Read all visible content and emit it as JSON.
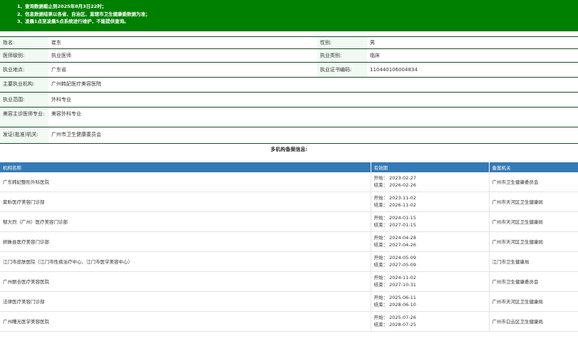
{
  "notice": [
    "1、查询数据截止到2025年8月3日22时；",
    "2、信息数据结果以各省、自治区、直辖市卫生健康委数据为准；",
    "3、凌晨1点至凌晨5点系统进行维护，不能提供查询。"
  ],
  "info": {
    "name_label": "姓名:",
    "name": "崔东",
    "gender_label": "性别:",
    "gender": "男",
    "level_label": "医师级别:",
    "level": "执业医师",
    "category_label": "执业类别:",
    "category": "临床",
    "place_label": "执业地点:",
    "place": "广东省",
    "cert_label": "执业证书编码:",
    "cert": "110440106004834",
    "org_label": "主要执业机构:",
    "org": "广州韩妃医疗美容医院",
    "scope_label": "执业范围:",
    "scope": "外科专业",
    "beauty_label": "美容主诊医师专业:",
    "beauty": "美容外科专业",
    "issuer_label": "发证(批准)机关:",
    "issuer": "广州市卫生健康委员会"
  },
  "multi_title": "多机构备案信息:",
  "orgs_header": {
    "name": "机构名称",
    "valid": "有效期",
    "authority": "备案机关"
  },
  "orgs": [
    {
      "name": "广东韩妃整形外科医院",
      "start": "开始：  2023-02-27",
      "end": "结束：  2026-02-26",
      "authority": "广州市卫生健康委员会"
    },
    {
      "name": "紫昕医疗美容门诊部",
      "start": "开始：  2023-11-02",
      "end": "结束：  2026-11-02",
      "authority": "广州市天河区卫生健康局"
    },
    {
      "name": "郁大烈（广州）医疗美容门诊部",
      "start": "开始：  2024-01-15",
      "end": "结束：  2027-01-15",
      "authority": "广州市天河区卫生健康局"
    },
    {
      "name": "妍姝县医疗美容门诊部",
      "start": "开始：  2024-04-28",
      "end": "结束：  2027-04-26",
      "authority": "广州市天河区卫生健康局"
    },
    {
      "name": "江门市皮肤医院（江门市性病治疗中心、江门市医学美容中心）",
      "start": "开始：  2024-05-09",
      "end": "结束：  2027-05-09",
      "authority": "江门市卫生健康局"
    },
    {
      "name": "广州丽合医疗美容医院",
      "start": "开始：  2024-11-02",
      "end": "结束：  2027-10-31",
      "authority": "广州市卫生健康委员会"
    },
    {
      "name": "法律医疗美容门诊部",
      "start": "开始：  2025-06-11",
      "end": "结束：  2028-06-10",
      "authority": "广州市天河区卫生健康局"
    },
    {
      "name": "广州曙光医学美容医院",
      "start": "开始：  2025-07-26",
      "end": "结束：  2028-07-25",
      "authority": "广州市白云区卫生健康局"
    }
  ]
}
